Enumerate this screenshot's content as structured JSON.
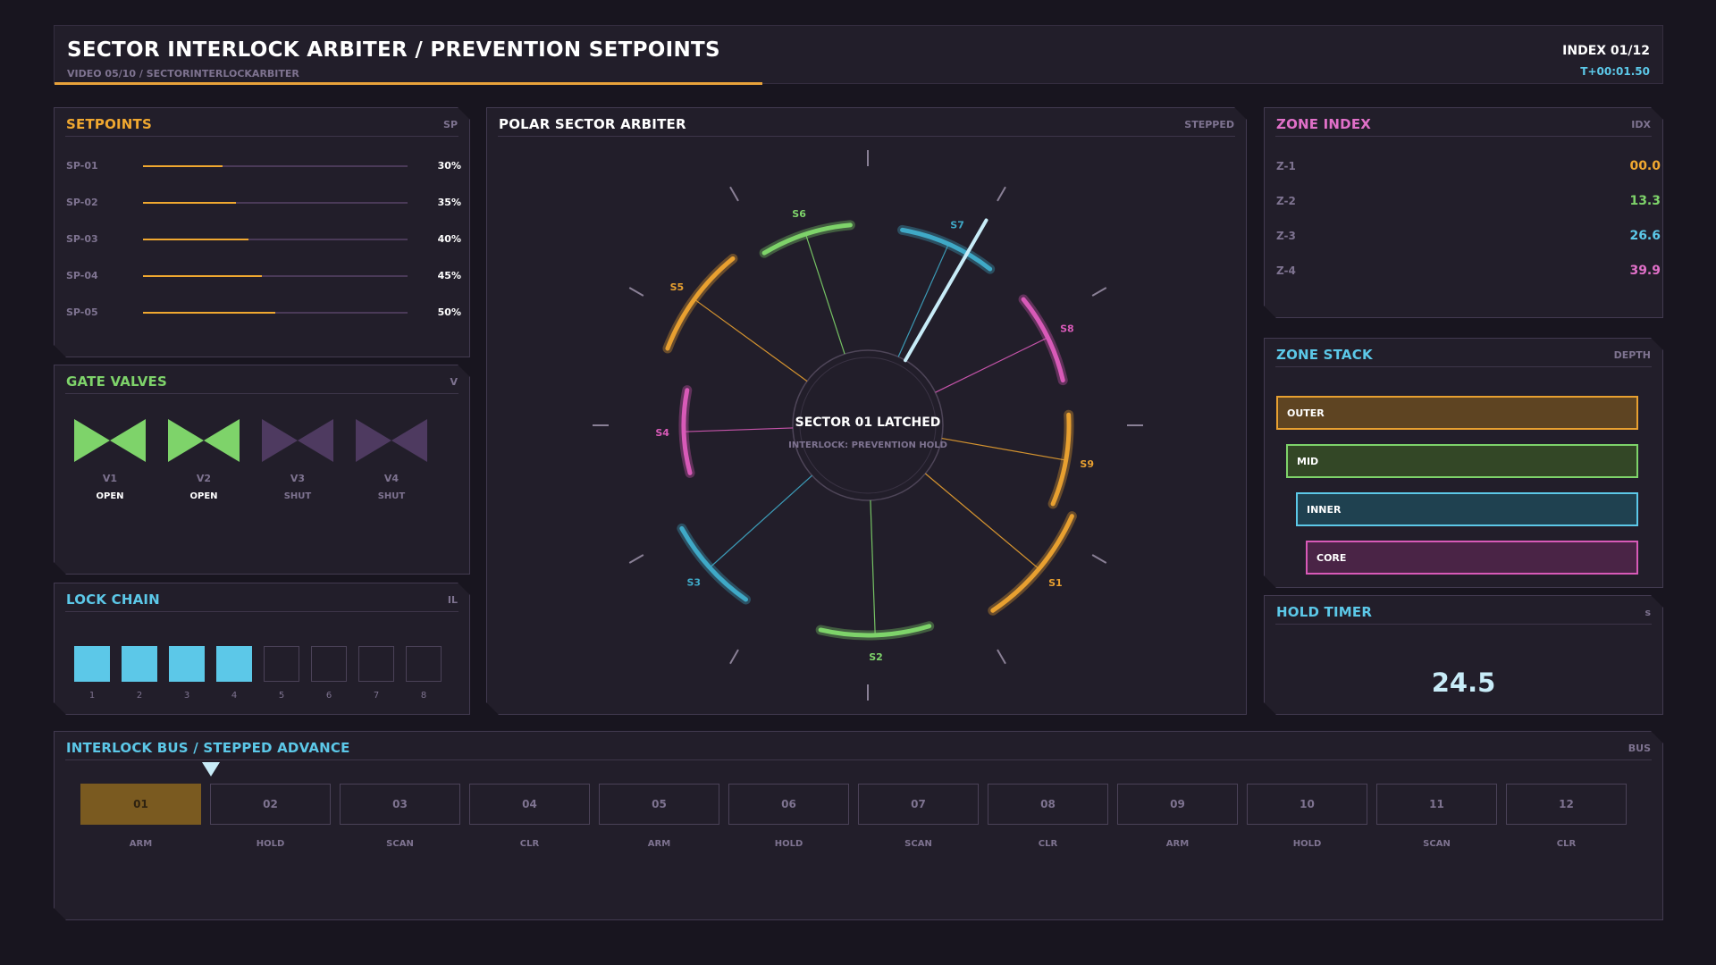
{
  "header": {
    "title": "SECTOR INTERLOCK ARBITER / PREVENTION SETPOINTS",
    "subtitle": "VIDEO 05/10 / SECTORINTERLOCKARBITER",
    "index": "INDEX 01/12",
    "time": "T+00:01.50",
    "progress": 0.44
  },
  "setpoints": {
    "title": "SETPOINTS",
    "tag": "SP",
    "items": [
      {
        "label": "SP-01",
        "value": "30%",
        "fraction": 0.3
      },
      {
        "label": "SP-02",
        "value": "35%",
        "fraction": 0.35
      },
      {
        "label": "SP-03",
        "value": "40%",
        "fraction": 0.4
      },
      {
        "label": "SP-04",
        "value": "45%",
        "fraction": 0.45
      },
      {
        "label": "SP-05",
        "value": "50%",
        "fraction": 0.5
      }
    ]
  },
  "valves": {
    "title": "GATE VALVES",
    "tag": "V",
    "items": [
      {
        "label": "V1",
        "state": "OPEN"
      },
      {
        "label": "V2",
        "state": "OPEN"
      },
      {
        "label": "V3",
        "state": "SHUT"
      },
      {
        "label": "V4",
        "state": "SHUT"
      }
    ]
  },
  "lockchain": {
    "title": "LOCK CHAIN",
    "tag": "IL",
    "cells": [
      "1",
      "2",
      "3",
      "4",
      "5",
      "6",
      "7",
      "8"
    ],
    "active_count": 4
  },
  "polar": {
    "title": "POLAR SECTOR ARBITER",
    "tag": "STEPPED",
    "center_title": "SECTOR 01 LATCHED",
    "center_sub": "INTERLOCK: PREVENTION HOLD",
    "sectors": [
      {
        "label": "S1",
        "color": "#e8a030"
      },
      {
        "label": "S2",
        "color": "#7ed36a"
      },
      {
        "label": "S3",
        "color": "#3fa9c7"
      },
      {
        "label": "S4",
        "color": "#d85ab8"
      },
      {
        "label": "S5",
        "color": "#e8a030"
      },
      {
        "label": "S6",
        "color": "#7ed36a"
      },
      {
        "label": "S7",
        "color": "#3fa9c7"
      },
      {
        "label": "S8",
        "color": "#d85ab8"
      },
      {
        "label": "S9",
        "color": "#e8a030"
      }
    ]
  },
  "zone_index": {
    "title": "ZONE INDEX",
    "tag": "IDX",
    "items": [
      {
        "label": "Z-1",
        "value": "00.0",
        "color": "#f0a830"
      },
      {
        "label": "Z-2",
        "value": "13.3",
        "color": "#7ed36a"
      },
      {
        "label": "Z-3",
        "value": "26.6",
        "color": "#5cc8e8"
      },
      {
        "label": "Z-4",
        "value": "39.9",
        "color": "#e070c8"
      }
    ]
  },
  "zone_stack": {
    "title": "ZONE STACK",
    "tag": "DEPTH",
    "items": [
      {
        "label": "OUTER",
        "border": "#e8a030",
        "fill": "#5e4422"
      },
      {
        "label": "MID",
        "border": "#7ed36a",
        "fill": "#334726"
      },
      {
        "label": "INNER",
        "border": "#5cc8e8",
        "fill": "#1f4150"
      },
      {
        "label": "CORE",
        "border": "#d85ab8",
        "fill": "#4a2446"
      }
    ]
  },
  "hold_timer": {
    "title": "HOLD TIMER",
    "tag": "s",
    "value": "24.5"
  },
  "bus": {
    "title": "INTERLOCK BUS / STEPPED ADVANCE",
    "tag": "BUS",
    "active_index": 0,
    "steps": [
      {
        "num": "01",
        "label": "ARM"
      },
      {
        "num": "02",
        "label": "HOLD"
      },
      {
        "num": "03",
        "label": "SCAN"
      },
      {
        "num": "04",
        "label": "CLR"
      },
      {
        "num": "05",
        "label": "ARM"
      },
      {
        "num": "06",
        "label": "HOLD"
      },
      {
        "num": "07",
        "label": "SCAN"
      },
      {
        "num": "08",
        "label": "CLR"
      },
      {
        "num": "09",
        "label": "ARM"
      },
      {
        "num": "10",
        "label": "HOLD"
      },
      {
        "num": "11",
        "label": "SCAN"
      },
      {
        "num": "12",
        "label": "CLR"
      }
    ]
  },
  "colors": {
    "accent_orange": "#f0a830",
    "accent_green": "#7ed36a",
    "accent_cyan": "#5cc8e8",
    "accent_magenta": "#e070c8"
  }
}
